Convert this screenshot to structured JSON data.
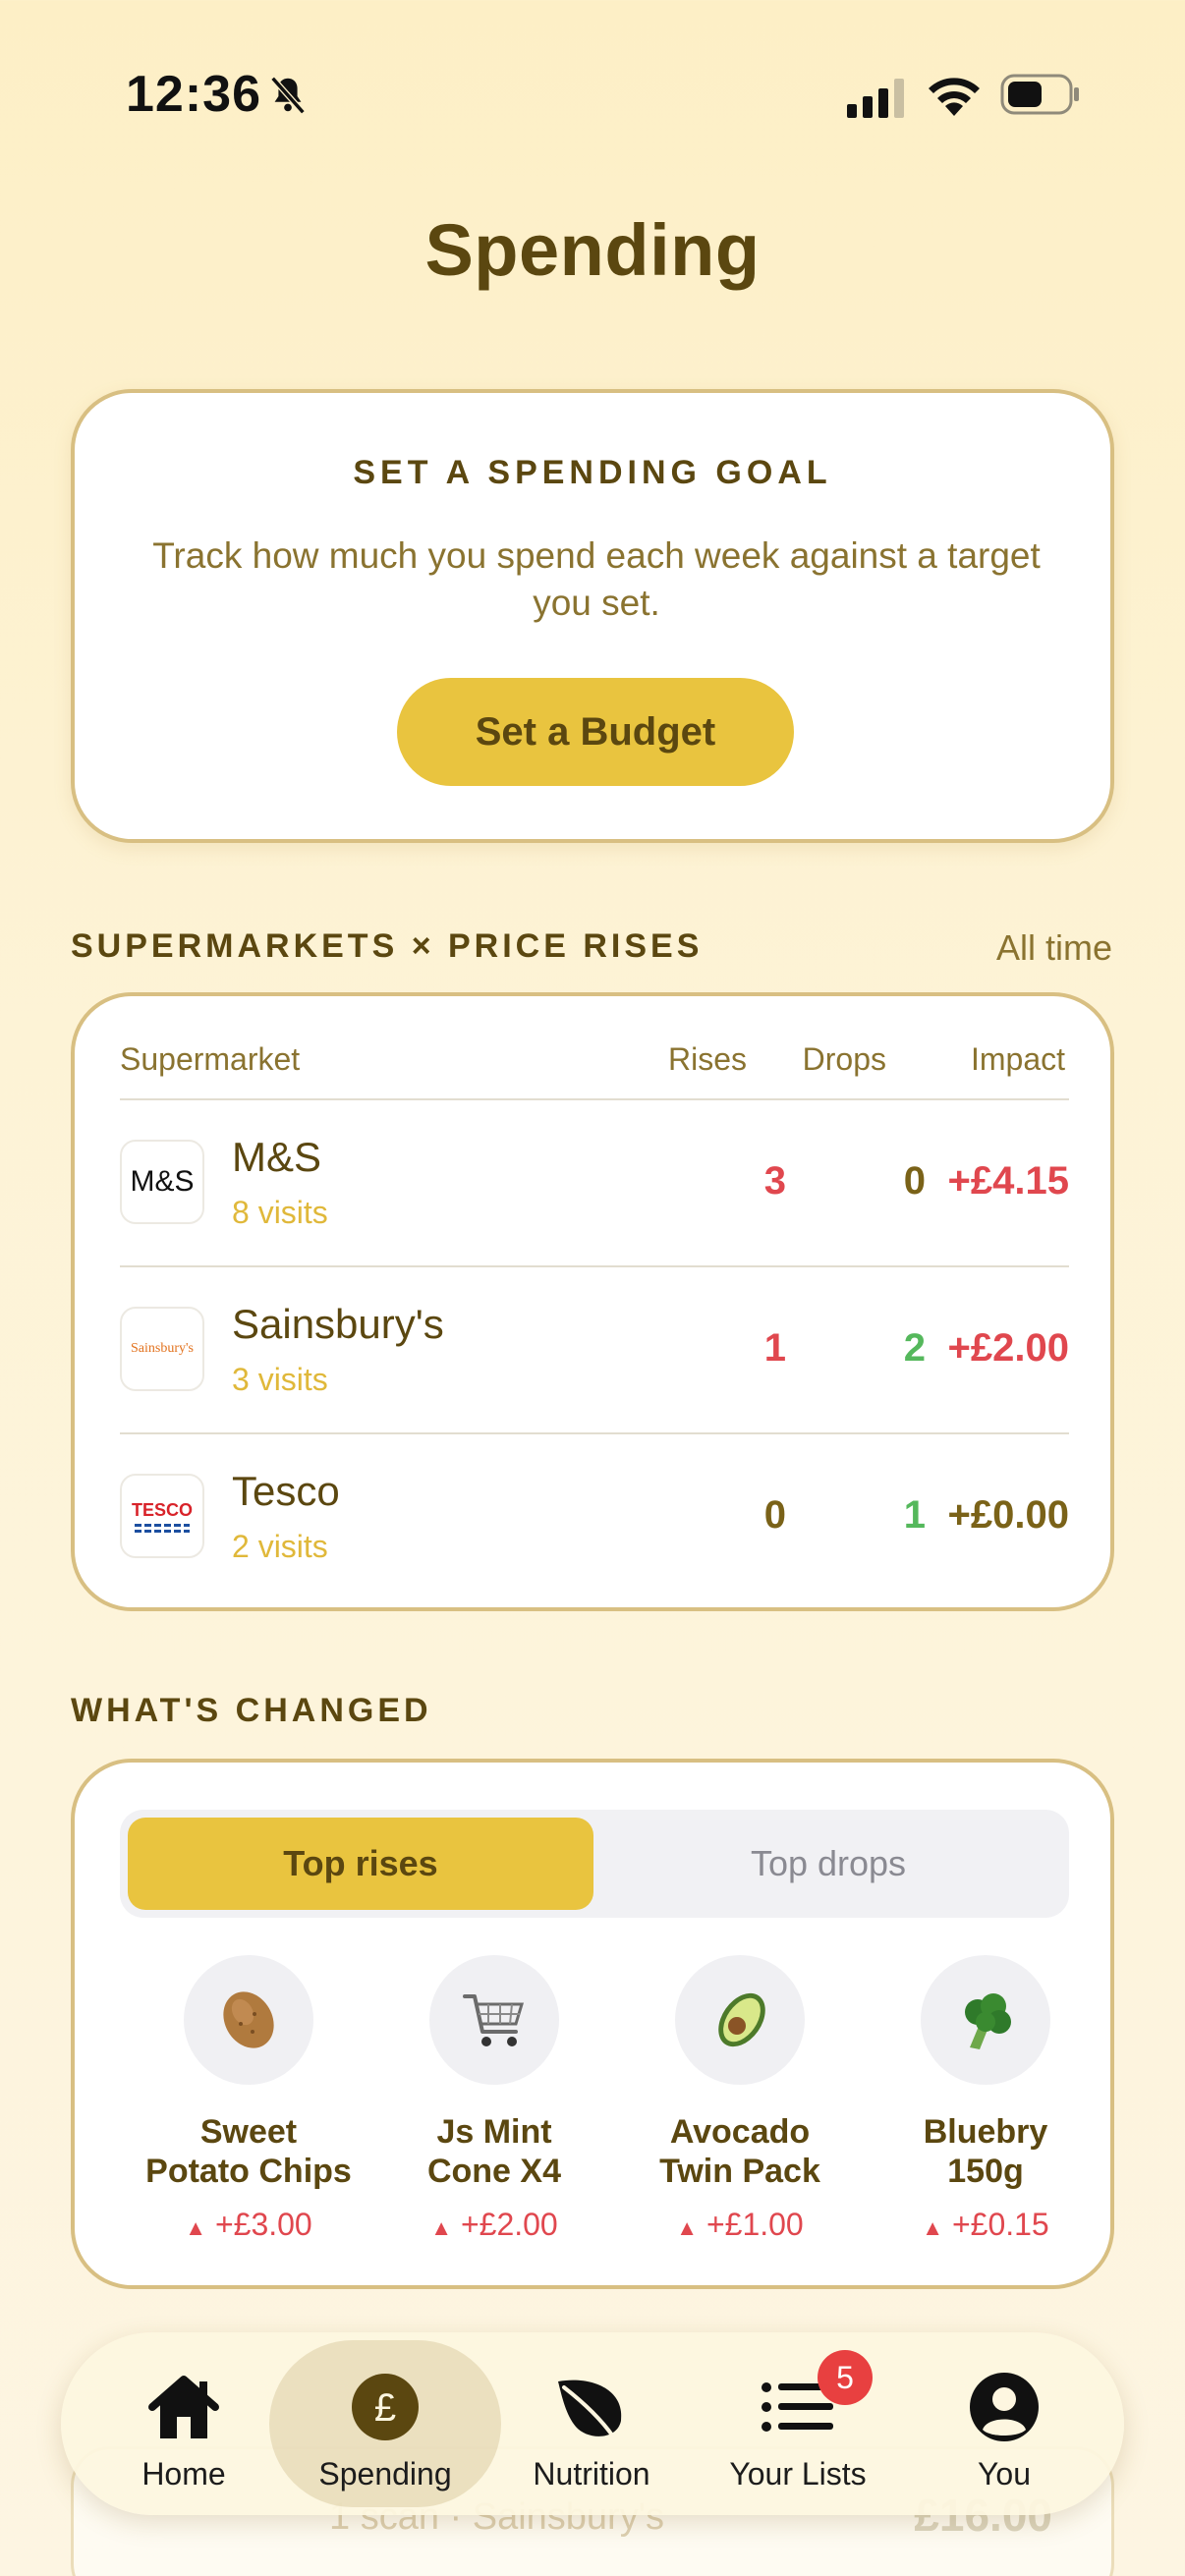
{
  "status_bar": {
    "time": "12:36"
  },
  "page": {
    "title": "Spending"
  },
  "goal_card": {
    "heading": "SET A SPENDING GOAL",
    "description": "Track how much you spend each week against a target you set.",
    "button_label": "Set a Budget"
  },
  "supermarkets": {
    "section_label": "SUPERMARKETS × PRICE RISES",
    "range_label": "All time",
    "columns": {
      "supermarket": "Supermarket",
      "rises": "Rises",
      "drops": "Drops",
      "impact": "Impact"
    },
    "rows": [
      {
        "name": "M&S",
        "visits": "8 visits",
        "rises": "3",
        "drops": "0",
        "impact": "+£4.15",
        "logo_text": "M&S"
      },
      {
        "name": "Sainsbury's",
        "visits": "3 visits",
        "rises": "1",
        "drops": "2",
        "impact": "+£2.00",
        "logo_text": "Sainsbury's"
      },
      {
        "name": "Tesco",
        "visits": "2 visits",
        "rises": "0",
        "drops": "1",
        "impact": "+£0.00",
        "logo_text": "TESCO"
      }
    ]
  },
  "changed": {
    "section_label": "WHAT'S CHANGED",
    "tabs": {
      "rises": "Top rises",
      "drops": "Top drops"
    },
    "selected_tab": "Top rises",
    "items": [
      {
        "name_line1": "Sweet",
        "name_line2": "Potato Chips",
        "delta": "+£3.00",
        "icon": "potato-icon"
      },
      {
        "name_line1": "Js Mint",
        "name_line2": "Cone X4",
        "delta": "+£2.00",
        "icon": "shopping-cart-icon"
      },
      {
        "name_line1": "Avocado",
        "name_line2": "Twin Pack",
        "delta": "+£1.00",
        "icon": "avocado-icon"
      },
      {
        "name_line1": "Bluebry",
        "name_line2": "150g",
        "delta": "+£0.15",
        "icon": "broccoli-icon"
      }
    ]
  },
  "peek_row": {
    "text": "1 scan · Sainsbury's",
    "price": "£16.00"
  },
  "tab_bar": {
    "home": "Home",
    "spending": "Spending",
    "nutrition": "Nutrition",
    "lists": "Your Lists",
    "lists_badge": "5",
    "you": "You",
    "active": "Spending"
  },
  "colors": {
    "accent": "#e9c43f",
    "text_brown": "#5b4710",
    "rise_red": "#e0474e",
    "drop_green": "#55b85c"
  }
}
